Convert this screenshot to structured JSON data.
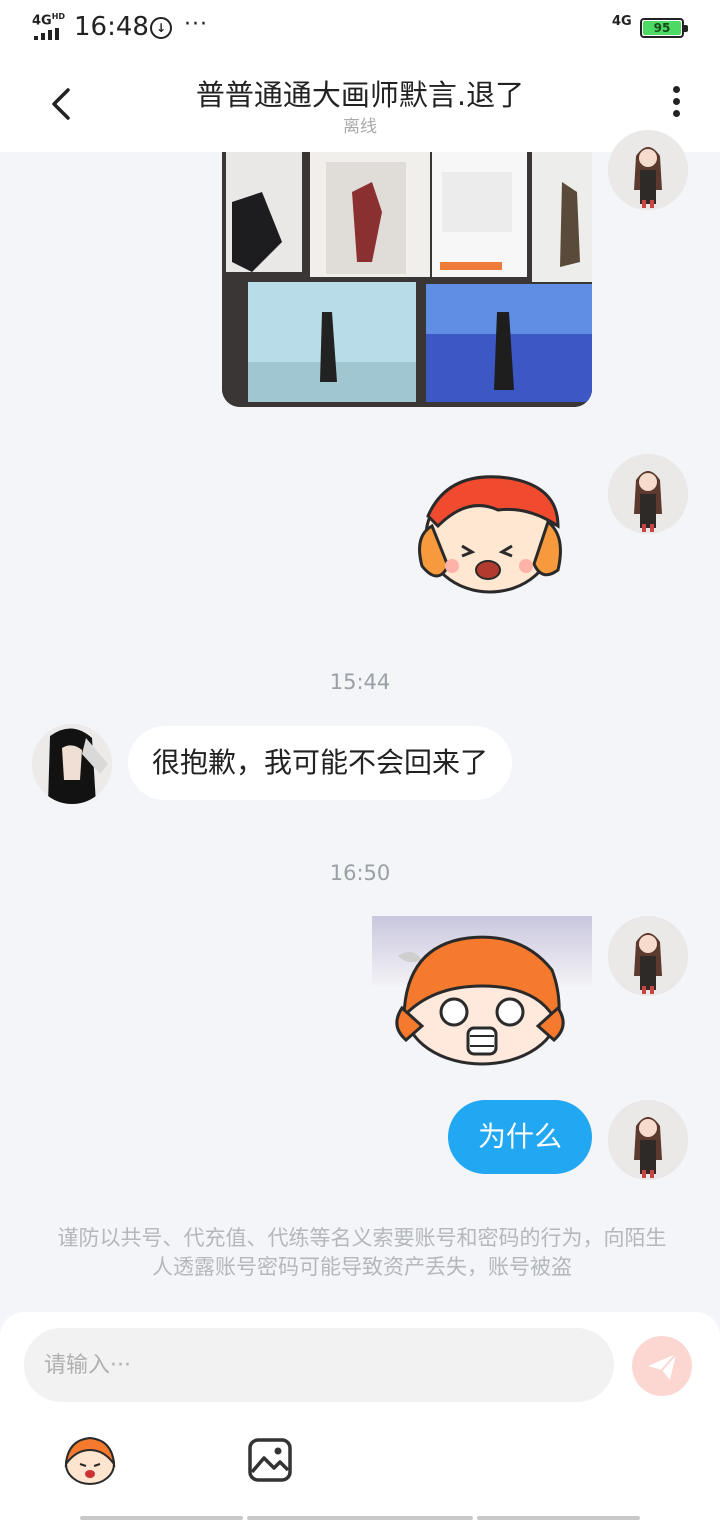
{
  "status_bar": {
    "network": "4G",
    "network_sup": "HD",
    "time": "16:48",
    "more": "···",
    "right_network": "4G",
    "battery": "95"
  },
  "header": {
    "title": "普普通通大画师默言.退了",
    "status": "离线"
  },
  "messages": {
    "timestamp1": "15:44",
    "incoming_text": "很抱歉，我可能不会回来了",
    "timestamp2": "16:50",
    "outgoing_text": "为什么"
  },
  "notice": "谨防以共号、代充值、代练等名义索要账号和密码的行为，向陌生人透露账号密码可能导致资产丢失，账号被盗",
  "input": {
    "placeholder": "请输入···"
  },
  "colors": {
    "accent_blue": "#22a7f2",
    "send_button": "#fcd7d2",
    "background": "#f3f5f8"
  },
  "icons": {
    "back": "chevron-left",
    "more": "vertical-dots",
    "send": "paper-plane",
    "emoji": "mascot-face",
    "image": "image-frame"
  }
}
